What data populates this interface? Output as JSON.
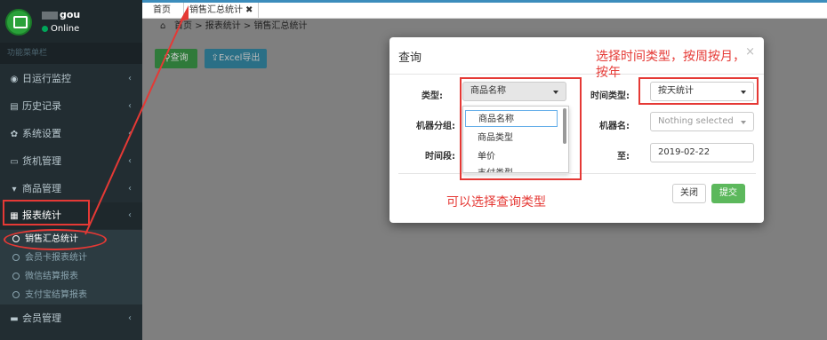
{
  "user": {
    "name": "gou",
    "status": "Online"
  },
  "sidebar": {
    "header": "功能菜单栏",
    "items": [
      {
        "label": "日运行监控",
        "icon": "eye-icon"
      },
      {
        "label": "历史记录",
        "icon": "list-icon"
      },
      {
        "label": "系统设置",
        "icon": "gear-icon"
      },
      {
        "label": "货机管理",
        "icon": "laptop-icon"
      },
      {
        "label": "商品管理",
        "icon": "cart-icon"
      },
      {
        "label": "报表统计",
        "icon": "table-icon"
      }
    ],
    "subitems": [
      "销售汇总统计",
      "会员卡报表统计",
      "微信结算报表",
      "支付宝结算报表"
    ],
    "bottom_item": {
      "label": "会员管理",
      "icon": "card-icon"
    }
  },
  "tabs": [
    {
      "label": "首页"
    },
    {
      "label": "销售汇总统计"
    }
  ],
  "breadcrumb": {
    "home": "首页",
    "path": "> 报表统计 > 销售汇总统计"
  },
  "toolbar": {
    "query_label": "查询",
    "export_label": "Excel导出"
  },
  "modal": {
    "title": "查询",
    "type_label": "类型:",
    "type_value": "商品名称",
    "type_options": [
      "商品名称",
      "商品类型",
      "单价",
      "支付类型"
    ],
    "time_type_label": "时间类型:",
    "time_type_value": "按天统计",
    "machine_group_label": "机器分组:",
    "machine_name_label": "机器名:",
    "machine_name_placeholder": "Nothing selected",
    "time_period_label": "时间段:",
    "to_label": "至:",
    "end_date": "2019-02-22",
    "close_label": "关闭",
    "submit_label": "提交"
  },
  "annotations": {
    "time_note": "选择时间类型，按周按月，按年",
    "type_note": "可以选择查询类型"
  },
  "colors": {
    "accent": "#3c8dbc",
    "annotation": "#e53935",
    "success": "#5cb85c",
    "sidebar": "#222d32"
  }
}
